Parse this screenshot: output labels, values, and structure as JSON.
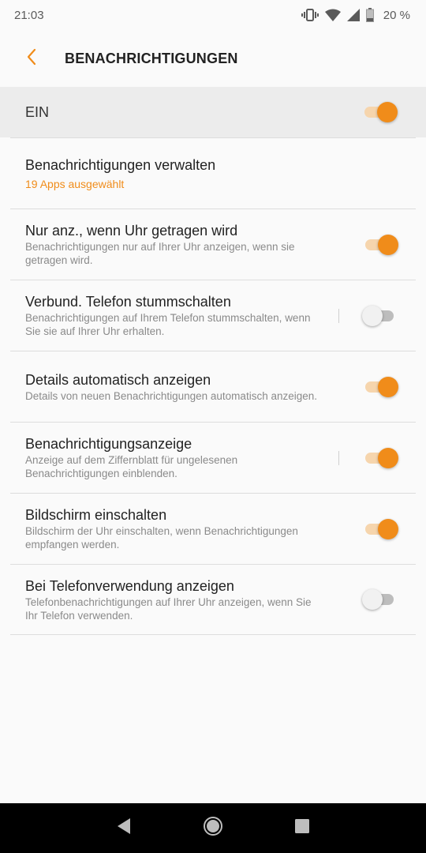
{
  "status_bar": {
    "time": "21:03",
    "battery": "20 %",
    "icons": [
      "vibrate-icon",
      "wifi-icon",
      "signal-icon",
      "battery-icon"
    ]
  },
  "header": {
    "title": "BENACHRICHTIGUNGEN",
    "back_icon": "chevron-left-icon"
  },
  "master": {
    "label": "EIN",
    "enabled": true
  },
  "settings": [
    {
      "title": "Benachrichtigungen verwalten",
      "subtitle": "19 Apps ausgewählt"
    },
    {
      "title": "Nur anz., wenn Uhr getragen wird",
      "description": "Benachrichtigungen nur auf Ihrer Uhr anzeigen, wenn sie getragen wird.",
      "enabled": true
    },
    {
      "title": "Verbund. Telefon stummschalten",
      "description": "Benachrichtigungen auf Ihrem Telefon stummschalten, wenn Sie sie auf Ihrer Uhr erhalten.",
      "enabled": false
    },
    {
      "title": "Details automatisch anzeigen",
      "description": "Details von neuen Benachrichtigungen automatisch anzeigen.",
      "enabled": true
    },
    {
      "title": "Benachrichtigungsanzeige",
      "description": "Anzeige auf dem Ziffernblatt für ungelesenen Benachrichtigungen einblenden.",
      "enabled": true
    },
    {
      "title": "Bildschirm einschalten",
      "description": "Bildschirm der Uhr einschalten, wenn Benachrichtigungen empfangen werden.",
      "enabled": true
    },
    {
      "title": "Bei Telefonverwendung anzeigen",
      "description": "Telefonbenachrichtigungen auf Ihrer Uhr anzeigen, wenn Sie Ihr Telefon verwenden.",
      "enabled": false
    }
  ],
  "colors": {
    "accent": "#f08c1a",
    "accent_track": "#f6d5ad",
    "off_track": "#bdbdbd",
    "background": "#fafafa"
  },
  "nav_bar": {
    "icons": [
      "back-triangle-icon",
      "home-circle-icon",
      "recents-square-icon"
    ]
  }
}
